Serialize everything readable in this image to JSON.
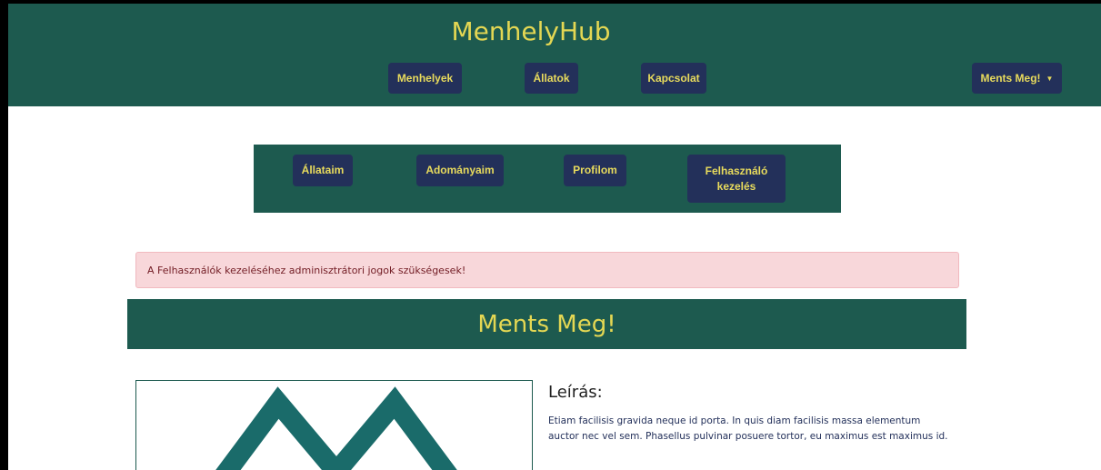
{
  "navbar": {
    "brand": "MenhelyHub",
    "links": [
      "Menhelyek",
      "Állatok",
      "Kapcsolat"
    ],
    "dropdown_label": "Ments Meg!"
  },
  "subnav": {
    "items": [
      "Állataim",
      "Adományaim",
      "Profilom",
      "Felhasználó kezelés"
    ]
  },
  "alert": {
    "text": "A Felhasználók kezeléséhez adminisztrátori jogok szükségesek!"
  },
  "shelter": {
    "name": "Ments Meg!",
    "description_title": "Leírás:",
    "description_text": "Etiam facilisis gravida neque id porta. In quis diam facilisis massa elementum auctor nec vel sem. Phasellus pulvinar posuere tortor, eu maximus est maximus id."
  },
  "colors": {
    "primary": "#1d5a4f",
    "button": "#23305a",
    "accent": "#e4d753",
    "alert_bg": "#f8d7da"
  }
}
